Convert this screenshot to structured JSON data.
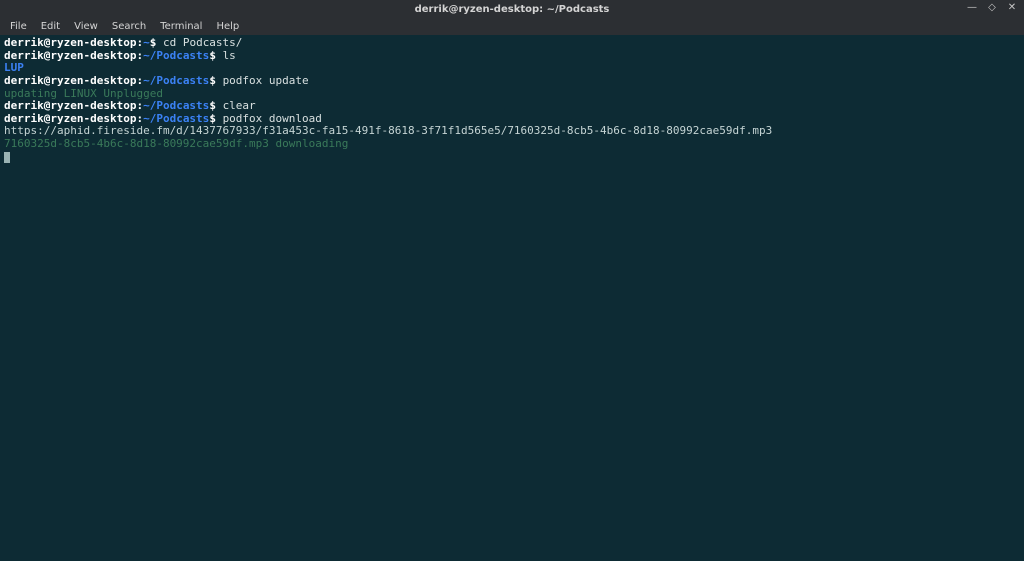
{
  "titlebar": {
    "title": "derrik@ryzen-desktop: ~/Podcasts",
    "minimize": "—",
    "maximize": "◇",
    "close": "✕"
  },
  "menubar": {
    "items": [
      "File",
      "Edit",
      "View",
      "Search",
      "Terminal",
      "Help"
    ]
  },
  "terminal": {
    "prompt": {
      "user_host": "derrik@ryzen-desktop",
      "home": "~",
      "podcasts": "~/Podcasts"
    },
    "lines": {
      "cmd1": "cd Podcasts/",
      "cmd2": "ls",
      "lup": "LUP",
      "cmd3": "podfox update",
      "updating": "updating LINUX Unplugged",
      "cmd4": "clear",
      "cmd5": "podfox download",
      "url": "https://aphid.fireside.fm/d/1437767933/f31a453c-fa15-491f-8618-3f71f1d565e5/7160325d-8cb5-4b6c-8d18-80992cae59df.mp3",
      "downloading": "7160325d-8cb5-4b6c-8d18-80992cae59df.mp3 downloading"
    }
  }
}
